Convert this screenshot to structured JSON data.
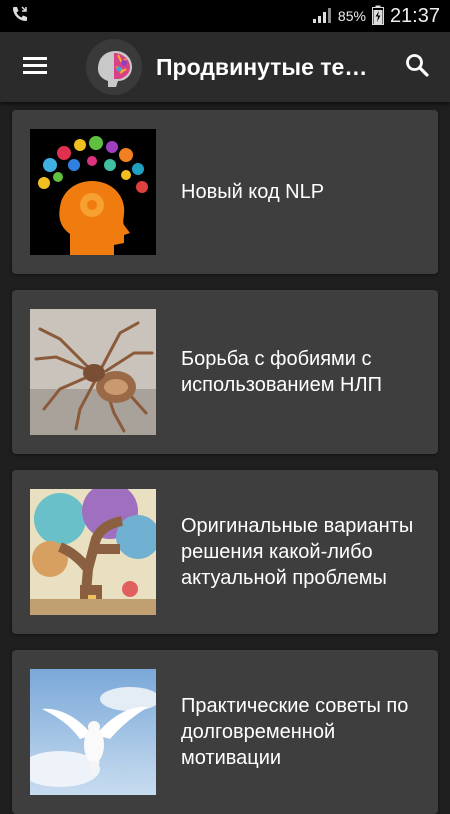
{
  "status": {
    "battery_percent": "85%",
    "time": "21:37"
  },
  "appbar": {
    "title": "Продвинутые те…"
  },
  "articles": [
    {
      "title": "Новый код NLP"
    },
    {
      "title": "Борьба с фобиями с использованием НЛП"
    },
    {
      "title": "Оригинальные варианты решения какой-либо актуальной проблемы"
    },
    {
      "title": "Практические советы по долговременной мотивации"
    }
  ]
}
